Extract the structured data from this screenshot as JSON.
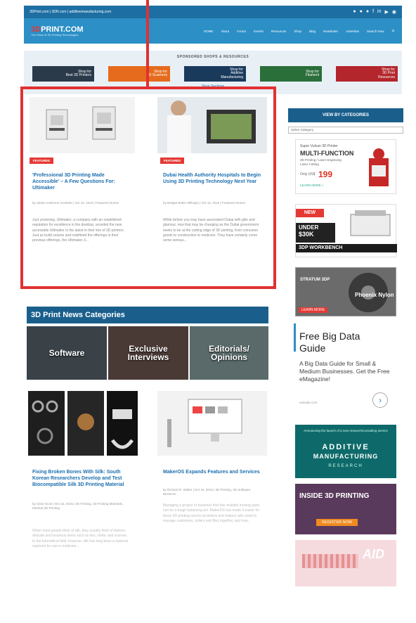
{
  "topbar": {
    "left_text": "3DPrint.com | 3DR.com | additivemanufacturing.com",
    "social_icons": [
      "twitter-icon",
      "google-plus-icon",
      "pinterest-icon",
      "facebook-icon",
      "linkedin-icon",
      "youtube-icon",
      "rss-icon"
    ]
  },
  "header": {
    "logo_text_red": "3D",
    "logo_text": "PRINT.COM",
    "logo_tagline": "The Voice of 3D Printing Technologies",
    "nav": [
      "HOME",
      "About",
      "Forum",
      "Events",
      "Resources",
      "Shop",
      "Blog",
      "Newsletter",
      "Advertise",
      "Search Now"
    ]
  },
  "sponsor": {
    "title": "SPONSORED SHOPS & RESOURCES",
    "buttons": [
      {
        "label": "Shop for\nBest 3D Printers",
        "color": "#2b3a4a"
      },
      {
        "label": "Shop for\n3D Scanners",
        "color": "#e66b1c"
      },
      {
        "label": "Shop for\nAdditive\nManufacturing",
        "color": "#1a3a5c"
      },
      {
        "label": "Shop for\nFilament",
        "color": "#2a6e3a"
      },
      {
        "label": "Shop for\n3D Print\nResources",
        "color": "#b3262c"
      }
    ],
    "link": "Shop Sections"
  },
  "articles": [
    {
      "badge": "FEATURED",
      "title": "'Professional 3D Printing Made Accessible' – A Few Questions For: Ultimaker",
      "meta": "by Sarah Anderson Goehrke | Oct 15, 2015 | Featured Stories",
      "excerpt": "Just yesterday, Ultimaker, a company with an established reputation for excellence in the desktop, unveiled the new accessible Ultimaker is the latest in their line of 3D printers. Just as build volume and redefined the offerings in their previous offerings, the Ultimaker 3..."
    },
    {
      "badge": "FEATURED",
      "title": "Dubai Health Authority Hospitals to Begin Using 3D Printing Technology Next Year",
      "meta": "by Bridget Butler Millsaps | Oct 15, 2015 | Featured Stories",
      "excerpt": "While before you may have associated Dubai with glitz and glamour, now that may be changing as the Dubai government seeks to be at the cutting edge of 3D printing, from consumer goods to construction to medicine. They have certainly come some serious..."
    }
  ],
  "categories": {
    "header": "3D Print News Categories",
    "tiles": [
      "Software",
      "Exclusive\nInterviews",
      "Editorials/\nOpinions"
    ]
  },
  "lower_articles": [
    {
      "title": "Fixing Broken Bones With Silk: South Korean Researchers Develop and Test Biocompatible Silk 3D Printing Material",
      "meta": "by Clare Scott | Oct 15, 2015 | 3D Printing, 3D Printing Materials, Medical 3D Printing",
      "excerpt": "When most people think of silk, they usually think of fashion, delicate and luxurious items such as ties, shirts, and scarves. In the biomedical field, however, silk has long been a material explored for use in medicine..."
    },
    {
      "title": "MakerOS Expands Features and Services",
      "meta": "by Richard R. Walter | Oct 15, 2015 | 3D Printing, 3D Software, Business",
      "excerpt": "Managing a project or business that has multiple moving parts can be a tough balancing act. MakerOS has made it easier for those 3D printing service providers and makers who need to manage customers, orders and files together, and now..."
    }
  ],
  "sidebar": {
    "view_categories": "VIEW BY CATEGORIES",
    "select_placeholder": "Select Category",
    "ad1": {
      "l1": "Super Vulcan 3D Printer",
      "l2": "MULTI-FUNCTION",
      "l3": "3D Printing / Laser Engraving",
      "l4": "Laser Cutting",
      "price": "199",
      "price_prefix": "Only US$",
      "cta": "LEARN MORE »"
    },
    "ad2": {
      "badge": "NEW",
      "l1": "UNDER",
      "l2": "$30K",
      "l3": "3DP WORKBENCH"
    },
    "ad3": {
      "brand": "STRATUM 3DP",
      "product": "Phoenix Nylon",
      "cta": "LEARN MORE"
    },
    "ad4": {
      "title": "Free Big Data Guide",
      "body": "A Big Data Guide for Small & Medium Businesses. Get the Free eMagazine!",
      "source": "netsuite.com"
    },
    "ad5": {
      "l1": "Announcing the launch of a new research/consulting service",
      "l2": "ADDITIVE",
      "l3": "MANUFACTURING",
      "l4": "RESEARCH"
    },
    "ad6": {
      "l1": "INSIDE 3D PRINTING",
      "l2": "REGISTER NOW"
    },
    "ad7": {
      "l1": "AID"
    }
  },
  "colors": {
    "accent": "#2c8fc6",
    "dark": "#1a5f8c",
    "highlight": "#e03131"
  }
}
